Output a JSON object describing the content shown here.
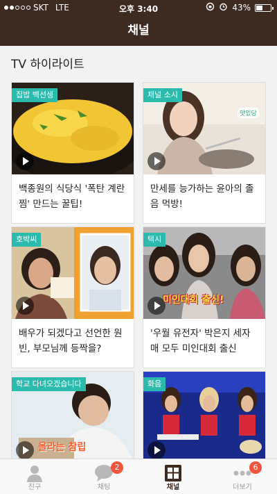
{
  "status_bar": {
    "carrier": "SKT",
    "network": "LTE",
    "time": "오후 3:40",
    "battery": "43%",
    "battery_level": 0.43
  },
  "header": {
    "title": "채널"
  },
  "section": {
    "title": "TV 하이라이트"
  },
  "cards": [
    {
      "tag": "집밥 백선생",
      "caption": "백종원의 식당식 '폭탄 계란찜' 만드는 꿀팁!"
    },
    {
      "tag": "채널 소시",
      "caption": "만세를 능가하는 윤아의 졸음 먹방!",
      "overlay": "맛있당"
    },
    {
      "tag": "호박씨",
      "caption": "배우가 되겠다고 선언한 원빈, 부모님께 등짝을?"
    },
    {
      "tag": "택시",
      "caption": "'우월 유전자' 박은지 세자매 모두 미인대회 출신",
      "overlay": "미인대회 출신!"
    },
    {
      "tag": "학교 다녀오겠습니다",
      "caption": "",
      "overlay": "올라는 참립"
    },
    {
      "tag": "화음",
      "caption": ""
    }
  ],
  "tab_bar": {
    "tabs": [
      {
        "label": "친구",
        "badge": ""
      },
      {
        "label": "채팅",
        "badge": "2"
      },
      {
        "label": "채널",
        "badge": ""
      },
      {
        "label": "더보기",
        "badge": "6"
      }
    ]
  },
  "colors": {
    "header": "#3d2a21",
    "tag": "#2bbbad",
    "badge": "#f2543d"
  }
}
